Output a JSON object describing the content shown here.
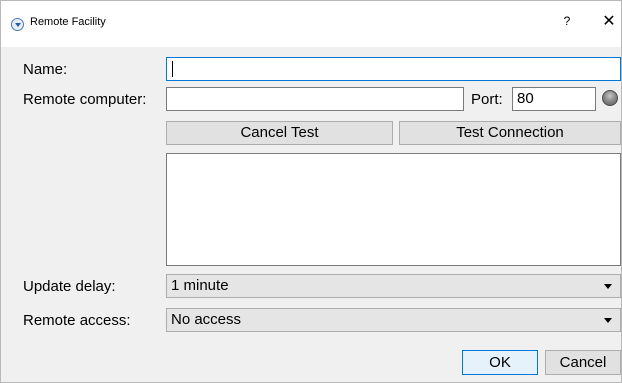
{
  "window": {
    "title": "Remote Facility",
    "help_label": "?",
    "close_label": "✕"
  },
  "form": {
    "name_label": "Name:",
    "name_value": "",
    "remote_computer_label": "Remote computer:",
    "remote_computer_value": "",
    "port_label": "Port:",
    "port_value": "80",
    "status_led_color": "#8c8c8c"
  },
  "buttons": {
    "cancel_test": "Cancel Test",
    "test_connection": "Test Connection",
    "ok": "OK",
    "cancel": "Cancel"
  },
  "log": {
    "text": ""
  },
  "settings": {
    "update_delay_label": "Update delay:",
    "update_delay_value": "1 minute",
    "remote_access_label": "Remote access:",
    "remote_access_value": "No access"
  },
  "colors": {
    "focus_border": "#0078d7",
    "window_bg": "#f0f0f0"
  }
}
